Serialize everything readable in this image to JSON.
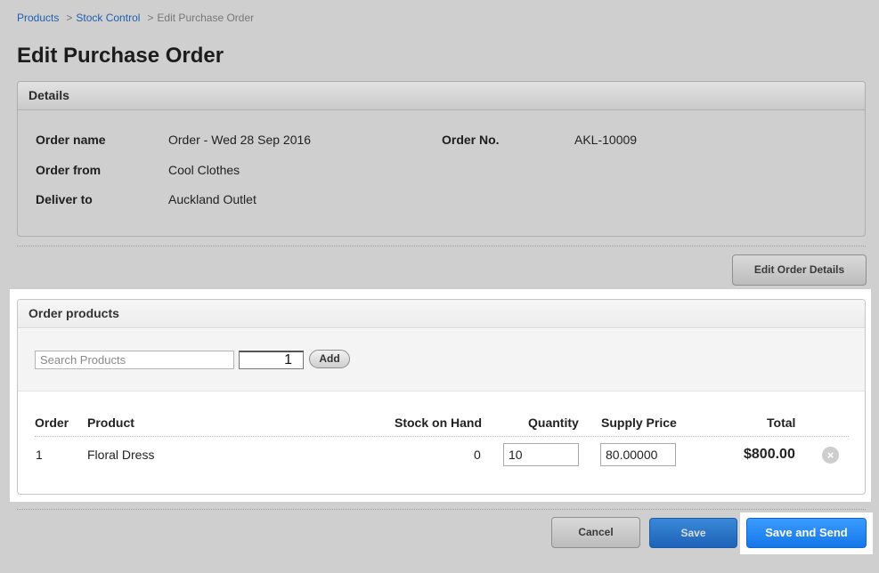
{
  "breadcrumb": {
    "items": [
      "Products",
      "Stock Control"
    ],
    "separator": ">",
    "current": "Edit Purchase Order"
  },
  "page": {
    "title": "Edit Purchase Order"
  },
  "details": {
    "header": "Details",
    "order_name_label": "Order name",
    "order_name_value": "Order - Wed 28 Sep 2016",
    "order_from_label": "Order from",
    "order_from_value": "Cool Clothes",
    "deliver_to_label": "Deliver to",
    "deliver_to_value": "Auckland Outlet",
    "order_no_label": "Order No.",
    "order_no_value": "AKL-10009"
  },
  "edit_button": "Edit Order Details",
  "order_products": {
    "header": "Order products",
    "search_placeholder": "Search Products",
    "quantity_value": "1",
    "add_label": "Add",
    "columns": {
      "order": "Order",
      "product": "Product",
      "stock_on_hand": "Stock on Hand",
      "quantity": "Quantity",
      "supply_price": "Supply Price",
      "total": "Total"
    },
    "rows": [
      {
        "order": "1",
        "product": "Floral Dress",
        "stock_on_hand": "0",
        "quantity": "10",
        "supply_price": "80.00000",
        "total": "$800.00"
      }
    ]
  },
  "actions": {
    "cancel": "Cancel",
    "save": "Save",
    "save_and_send": "Save and Send"
  },
  "colors": {
    "background": "#cfcfcf",
    "link": "#1f5fae",
    "primary_button": "#1477e8"
  },
  "icons": {
    "remove_row": "remove-circle-icon"
  }
}
